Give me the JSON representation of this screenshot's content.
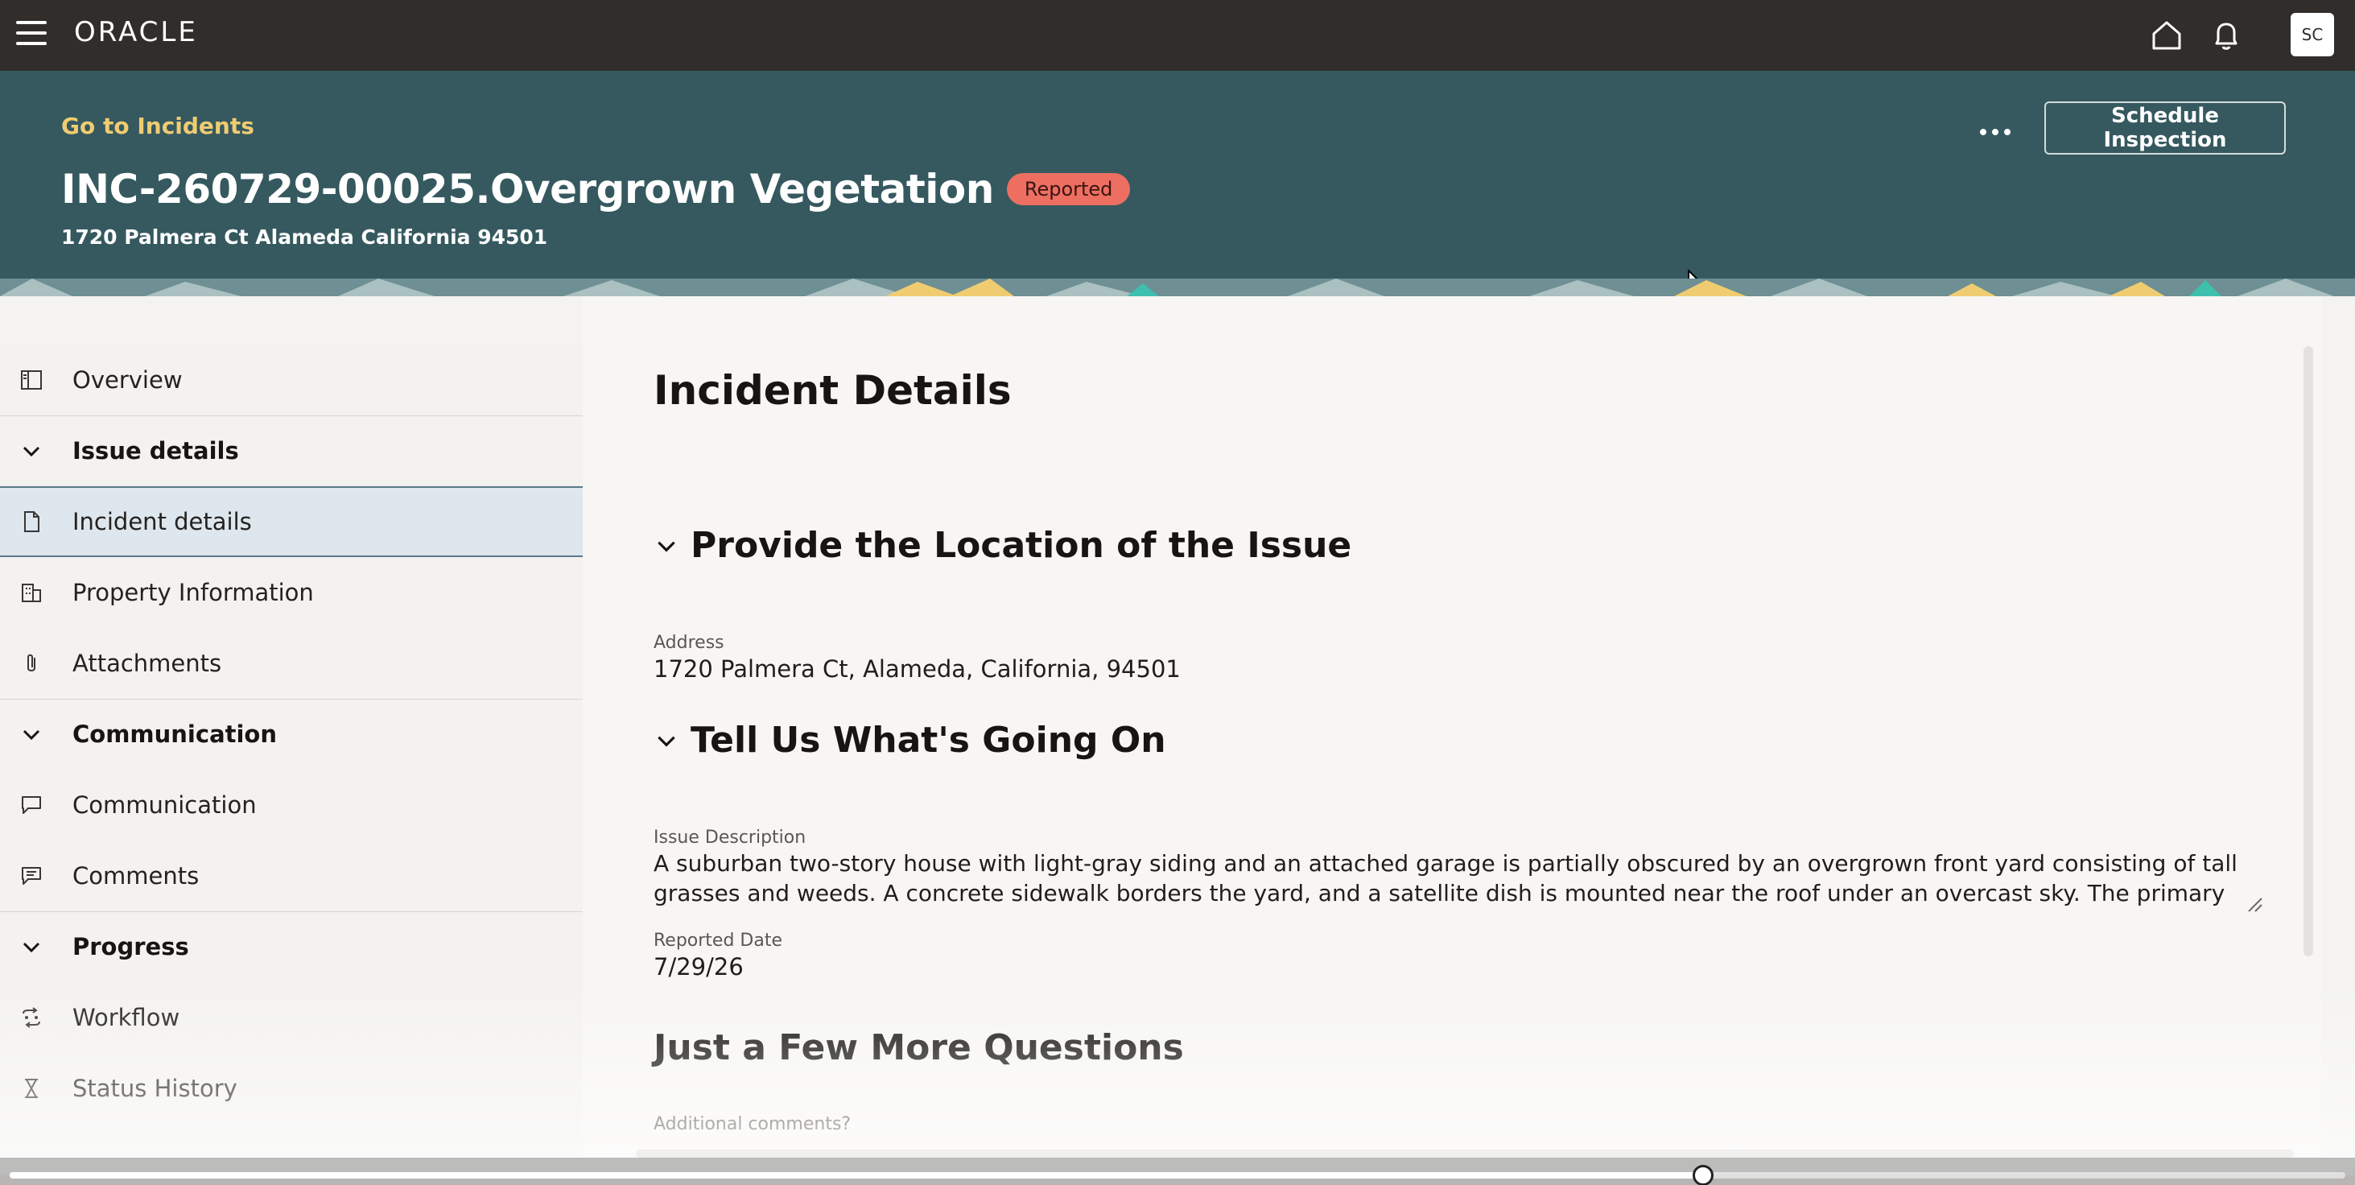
{
  "topbar": {
    "logo": "ORACLE",
    "avatar_initials": "SC"
  },
  "header": {
    "back_link": "Go to Incidents",
    "title": "INC-260729-00025.Overgrown Vegetation",
    "status": "Reported",
    "address": "1720 Palmera Ct Alameda California 94501",
    "schedule_button": "Schedule Inspection"
  },
  "sidebar": {
    "overview": "Overview",
    "issue_details": "Issue details",
    "incident_details": "Incident details",
    "property_information": "Property Information",
    "attachments": "Attachments",
    "communication_group": "Communication",
    "communication": "Communication",
    "comments": "Comments",
    "progress": "Progress",
    "workflow": "Workflow",
    "status_history": "Status History"
  },
  "main": {
    "title": "Incident Details",
    "location_section": "Provide the Location of the Issue",
    "address_label": "Address",
    "address_value": "1720 Palmera Ct, Alameda, California, 94501",
    "going_on_section": "Tell Us What's Going On",
    "issue_description_label": "Issue Description",
    "issue_description": "A suburban two-story house with light-gray siding and an attached garage is partially obscured by an overgrown front yard consisting of tall grasses and weeds. A concrete sidewalk borders the yard, and a satellite dish is mounted near the roof under an overcast sky. The primary visible issue is the",
    "reported_date_label": "Reported Date",
    "reported_date": "7/29/26",
    "more_questions_section": "Just a Few More Questions",
    "additional_comments_label": "Additional comments?"
  },
  "video": {
    "progress": 0.725
  },
  "colors": {
    "topbar": "#312d2a",
    "header": "#35595f",
    "link": "#f0cc71",
    "badge": "#ed6f62",
    "selected": "#dde7ed"
  }
}
